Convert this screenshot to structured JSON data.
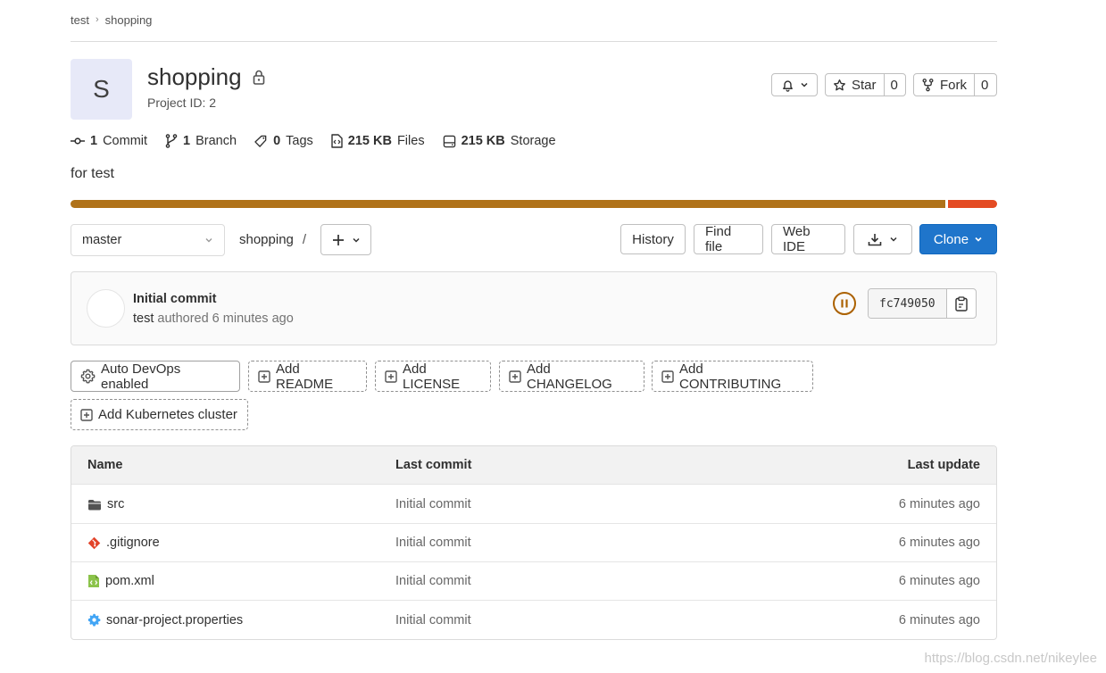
{
  "breadcrumb": {
    "group": "test",
    "project": "shopping"
  },
  "project": {
    "avatar_letter": "S",
    "name": "shopping",
    "id_label": "Project ID: 2",
    "description": "for test"
  },
  "actions": {
    "star_label": "Star",
    "star_count": "0",
    "fork_label": "Fork",
    "fork_count": "0"
  },
  "stats": {
    "commits_count": "1",
    "commits_label": "Commit",
    "branches_count": "1",
    "branches_label": "Branch",
    "tags_count": "0",
    "tags_label": "Tags",
    "files_size": "215 KB",
    "files_label": "Files",
    "storage_size": "215 KB",
    "storage_label": "Storage"
  },
  "languages": [
    {
      "fraction": 0.947,
      "color": "#b07219"
    },
    {
      "fraction": 0.053,
      "color": "#e44b23"
    }
  ],
  "toolbar": {
    "branch": "master",
    "path": "shopping",
    "path_sep": "/",
    "history": "History",
    "find_file": "Find file",
    "web_ide": "Web IDE",
    "clone": "Clone"
  },
  "last_commit": {
    "title": "Initial commit",
    "author": "test",
    "meta": "authored 6 minutes ago",
    "sha": "fc749050",
    "pipeline_color": "#ab6100"
  },
  "quick_actions": {
    "auto_devops": "Auto DevOps enabled",
    "readme": "Add README",
    "license": "Add LICENSE",
    "changelog": "Add CHANGELOG",
    "contributing": "Add CONTRIBUTING",
    "kubernetes": "Add Kubernetes cluster"
  },
  "table": {
    "headers": {
      "name": "Name",
      "last_commit": "Last commit",
      "last_update": "Last update"
    },
    "rows": [
      {
        "name": "src",
        "icon": "folder-icon",
        "commit": "Initial commit",
        "updated": "6 minutes ago"
      },
      {
        "name": ".gitignore",
        "icon": "git-icon",
        "commit": "Initial commit",
        "updated": "6 minutes ago"
      },
      {
        "name": "pom.xml",
        "icon": "xml-file-icon",
        "commit": "Initial commit",
        "updated": "6 minutes ago"
      },
      {
        "name": "sonar-project.properties",
        "icon": "settings-file-icon",
        "commit": "Initial commit",
        "updated": "6 minutes ago"
      }
    ]
  },
  "watermark": "https://blog.csdn.net/nikeylee"
}
